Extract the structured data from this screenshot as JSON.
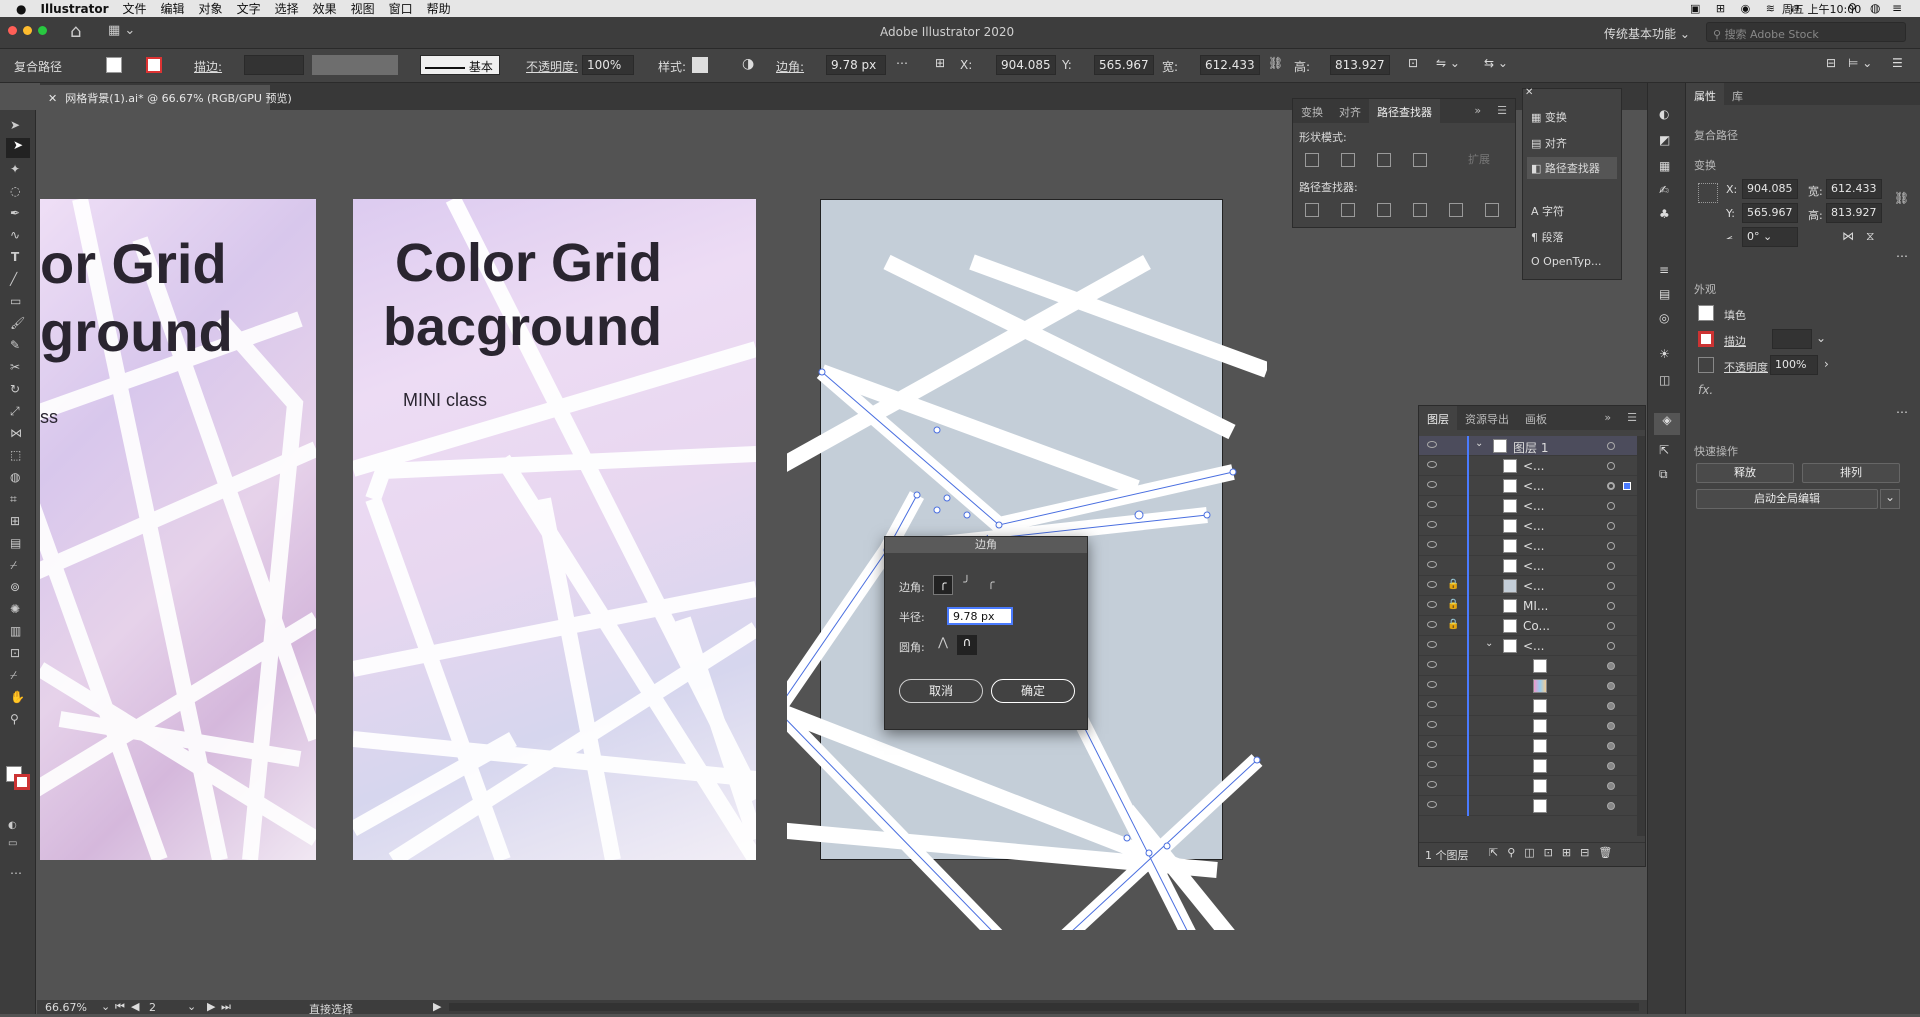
{
  "menubar": {
    "app": "Illustrator",
    "items": [
      "文件",
      "编辑",
      "对象",
      "文字",
      "选择",
      "效果",
      "视图",
      "窗口",
      "帮助"
    ],
    "clock": "周五 上午10:00"
  },
  "titlebar": {
    "title": "Adobe Illustrator 2020",
    "workspace": "传统基本功能",
    "search_placeholder": "搜索 Adobe Stock"
  },
  "control": {
    "object_type": "复合路径",
    "stroke_label": "描边:",
    "stroke_style": "基本",
    "opacity_label": "不透明度:",
    "opacity": "100%",
    "style_label": "样式:",
    "corner_label": "边角:",
    "corner_value": "9.78 px",
    "x_label": "X:",
    "x": "904.085 p",
    "y_label": "Y:",
    "y": "565.967 p",
    "w_label": "宽:",
    "w": "612.433 p",
    "h_label": "高:",
    "h": "813.927 p"
  },
  "document_tab": "网格背景(1).ai* @ 66.67% (RGB/GPU 预览)",
  "artboards": {
    "a1_line1": "or Grid",
    "a1_line2": "ground",
    "a1_sub": "ss",
    "a2_line1": "Color Grid",
    "a2_line2": "bacground",
    "a2_sub": "MINI class"
  },
  "pathfinder_panel": {
    "tabs": [
      "变换",
      "对齐",
      "路径查找器"
    ],
    "shape_modes": "形状模式:",
    "expand": "扩展",
    "pathfinders": "路径查找器:"
  },
  "mini_panel": {
    "items": [
      "变换",
      "对齐",
      "路径查找器",
      "字符",
      "段落",
      "OpenTyp..."
    ]
  },
  "corner_dialog": {
    "title": "边角",
    "corners_label": "边角:",
    "radius_label": "半径:",
    "radius": "9.78 px",
    "rounding_label": "圆角:",
    "cancel": "取消",
    "ok": "确定"
  },
  "layers_panel": {
    "tabs": [
      "图层",
      "资源导出",
      "画板"
    ],
    "layer_name": "图层 1",
    "rows": [
      "<...",
      "<...",
      "<...",
      "<...",
      "<...",
      "<...",
      "<...",
      "MI...",
      "Co...",
      "<..."
    ],
    "footer": "1 个图层"
  },
  "properties_panel": {
    "tabs": [
      "属性",
      "库"
    ],
    "object_type": "复合路径",
    "transform": "变换",
    "x_label": "X:",
    "x": "904.085",
    "w_label": "宽:",
    "w": "612.433",
    "y_label": "Y:",
    "y": "565.967",
    "h_label": "高:",
    "h": "813.927",
    "angle": "0°",
    "appearance": "外观",
    "fill": "填色",
    "stroke": "描边",
    "opacity_label": "不透明度",
    "opacity": "100%",
    "fx": "fx.",
    "quick_actions": "快速操作",
    "release": "释放",
    "arrange": "排列",
    "global_edit": "启动全局编辑"
  },
  "status": {
    "zoom": "66.67%",
    "page": "2",
    "tool": "直接选择"
  }
}
